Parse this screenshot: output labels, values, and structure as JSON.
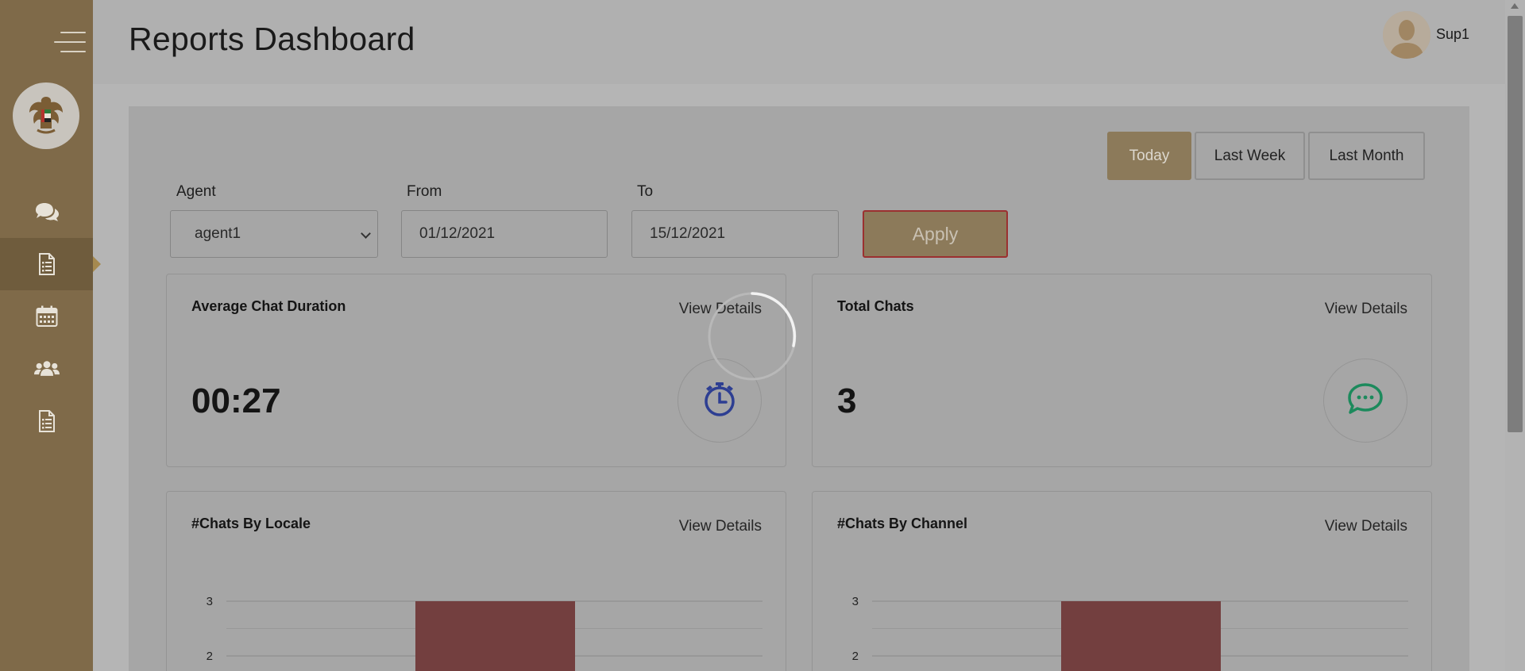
{
  "header": {
    "title": "Reports Dashboard",
    "user_name": "Sup1"
  },
  "sidebar": {
    "items": [
      {
        "icon": "chats-icon"
      },
      {
        "icon": "report-icon",
        "active": true
      },
      {
        "icon": "calendar-icon"
      },
      {
        "icon": "users-icon"
      },
      {
        "icon": "document-icon"
      }
    ]
  },
  "filters": {
    "range_buttons": [
      "Today",
      "Last Week",
      "Last Month"
    ],
    "active_range": "Today",
    "agent_label": "Agent",
    "agent_value": "agent1",
    "from_label": "From",
    "from_value": "01/12/2021",
    "to_label": "To",
    "to_value": "15/12/2021",
    "apply_label": "Apply"
  },
  "cards": {
    "avg_duration": {
      "title": "Average Chat Duration",
      "link": "View Details",
      "value": "00:27"
    },
    "total_chats": {
      "title": "Total Chats",
      "link": "View Details",
      "value": "3"
    },
    "by_locale": {
      "title": "#Chats By Locale",
      "link": "View Details"
    },
    "by_channel": {
      "title": "#Chats By Channel",
      "link": "View Details"
    }
  },
  "colors": {
    "accent": "#8c7a5a",
    "sidebar": "#7f6a49",
    "bar": "#733f3f",
    "clock_icon": "#2d3e92",
    "chat_icon": "#1c8a5c"
  },
  "chart_data": [
    {
      "type": "bar",
      "title": "#Chats By Locale",
      "visible_y_ticks": [
        "3",
        "2"
      ],
      "values": [
        3
      ],
      "ylim_visible": [
        2,
        3
      ]
    },
    {
      "type": "bar",
      "title": "#Chats By Channel",
      "visible_y_ticks": [
        "3",
        "2"
      ],
      "values": [
        3
      ],
      "ylim_visible": [
        2,
        3
      ]
    }
  ]
}
